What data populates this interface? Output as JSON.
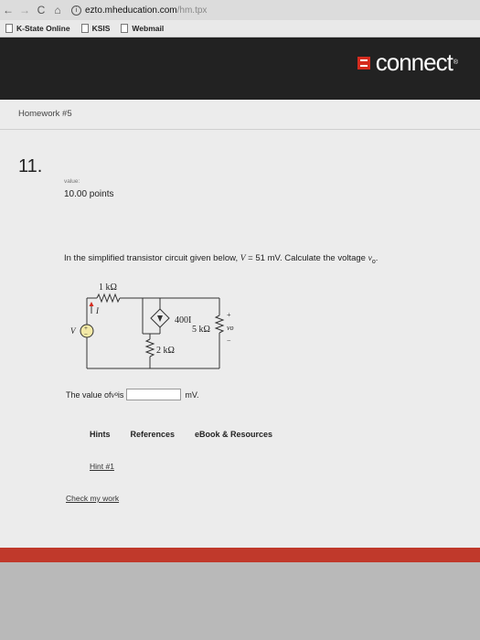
{
  "browser": {
    "back": "←",
    "forward": "→",
    "reload": "C",
    "home": "⌂",
    "info": "i",
    "url_host": "ezto.mheducation.com",
    "url_path": "/hm.tpx",
    "bookmarks": [
      "K-State Online",
      "KSIS",
      "Webmail"
    ]
  },
  "header": {
    "logo_text": "connect",
    "logo_tm": "®",
    "brand_color": "#d52b1e"
  },
  "homework": {
    "title": "Homework #5"
  },
  "question": {
    "number": "11.",
    "value_label": "value:",
    "points": "10.00 points",
    "prompt_pre": "In the simplified transistor circuit given below, ",
    "prompt_var": "V",
    "prompt_eq": " = 51 mV. Calculate the voltage ",
    "prompt_target": "v",
    "prompt_target_sub": "o",
    "prompt_end": "."
  },
  "circuit": {
    "r1_label": "1 kΩ",
    "current_label": "I",
    "source_label": "V",
    "source_sign": "+",
    "source_minus": "−",
    "dep_label": "400I",
    "r2_label": "2 kΩ",
    "r3_label": "5 kΩ",
    "vo_label": "vo",
    "vo_plus": "+",
    "vo_minus": "−"
  },
  "answer": {
    "prefix": "The value of ",
    "var": "v",
    "var_sub": "o",
    "mid": " is",
    "value": "",
    "unit": "mV."
  },
  "tabs": [
    "Hints",
    "References",
    "eBook & Resources"
  ],
  "hint_link": "Hint #1",
  "check_link": "Check my work"
}
